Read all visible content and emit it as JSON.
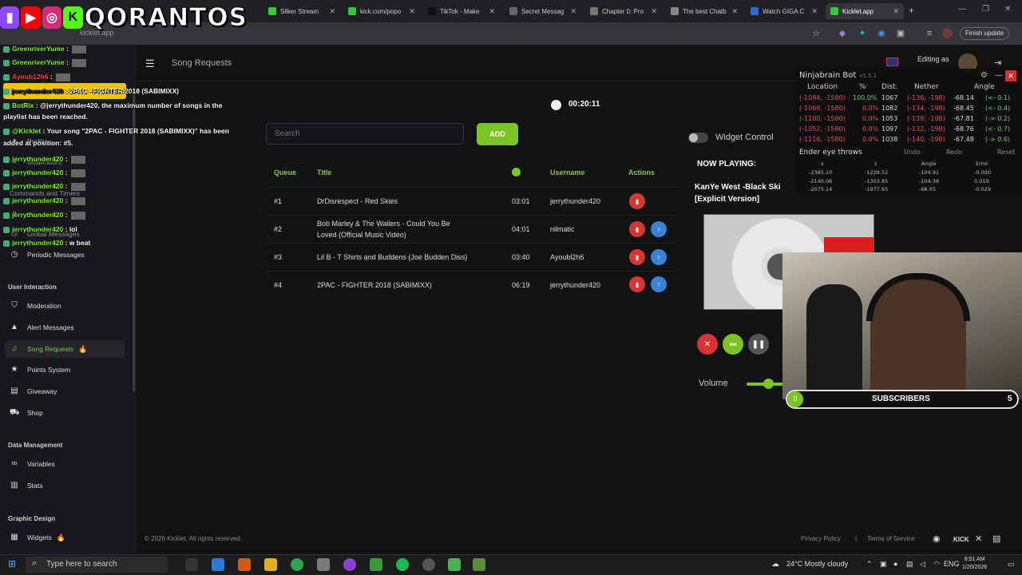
{
  "browser": {
    "tabs": [
      {
        "title": "Sliker Stream",
        "color": "#3ac73a"
      },
      {
        "title": "kick.com/popo",
        "color": "#3ac73a"
      },
      {
        "title": "TikTok - Make",
        "color": "#222222"
      },
      {
        "title": "Secret Messag",
        "color": "#666666"
      },
      {
        "title": "Chapter 0: Pro",
        "color": "#777777"
      },
      {
        "title": "The best Chatb",
        "color": "#888888"
      },
      {
        "title": "Watch GIGA C",
        "color": "#2b6cd6"
      },
      {
        "title": "Kicklet.app",
        "color": "#3ac73a"
      }
    ],
    "url": "kicklet.app",
    "finish_update": "Finish update"
  },
  "overlay_logo": "QORANTOS",
  "chat": [
    {
      "user": "GreenriverYume",
      "msg": ""
    },
    {
      "user": "GreenriverYume",
      "msg": ""
    },
    {
      "user": "Ayoub12h6",
      "msg": ""
    },
    {
      "user": "jerrythunder420",
      "msg": "2PAC - FIGHTER 2018 (SABIMIXX)"
    },
    {
      "user": "BotRix",
      "msg": "@jerrythunder420, the maximum number of songs in the"
    },
    {
      "user": "",
      "msg": "playlist has been reached."
    },
    {
      "user": "@Kicklet",
      "msg": "Your song \"2PAC - FIGHTER 2018 (SABIMIXX)\" has been"
    },
    {
      "user": "",
      "msg": "added at position: #5."
    },
    {
      "user": "jerrythunder420",
      "msg": ""
    },
    {
      "user": "jerrythunder420",
      "msg": ""
    },
    {
      "user": "jerrythunder420",
      "msg": ""
    },
    {
      "user": "jerrythunder420",
      "msg": ""
    },
    {
      "user": "jerrythunder420",
      "msg": ""
    },
    {
      "user": "jerrythunder420",
      "msg": "lol"
    },
    {
      "user": "jerrythunder420",
      "msg": "w beat"
    }
  ],
  "header": {
    "page_title": "Song Requests",
    "editing_as": "Editing as"
  },
  "sidebar": {
    "ghost_items": [
      "Profile",
      "Moderators",
      "Commands and Timers",
      "Counters",
      "Global Messages"
    ],
    "periodic": "Periodic Messages",
    "sections": {
      "user_interaction": "User Interaction",
      "data_management": "Data Management",
      "graphic_design": "Graphic Design"
    },
    "items": [
      {
        "label": "Moderation",
        "icon": "shield-icon"
      },
      {
        "label": "Alert Messages",
        "icon": "warning-icon"
      },
      {
        "label": "Song Requests",
        "icon": "music-icon"
      },
      {
        "label": "Points System",
        "icon": "star-icon"
      },
      {
        "label": "Giveaway",
        "icon": "gift-icon"
      },
      {
        "label": "Shop",
        "icon": "cart-icon"
      },
      {
        "label": "Variables",
        "icon": "link-icon"
      },
      {
        "label": "Stats",
        "icon": "chart-icon"
      },
      {
        "label": "Widgets",
        "icon": "widget-icon"
      }
    ]
  },
  "queue": {
    "timer": "00:20:11",
    "search_placeholder": "Search",
    "add_label": "ADD",
    "widget_control": "Widget Control",
    "headers": {
      "queue": "Queue",
      "title": "Title",
      "username": "Username",
      "actions": "Actions"
    },
    "rows": [
      {
        "pos": "#1",
        "title": "DrDisrespect - Red Skies",
        "title2": "",
        "duration": "03:01",
        "user": "jerrythunder420"
      },
      {
        "pos": "#2",
        "title": "Bob Marley & The Wailers - Could You Be",
        "title2": "Loved (Official Music Video)",
        "duration": "04:01",
        "user": "nilmatic"
      },
      {
        "pos": "#3",
        "title": "Lil B - T Shirts and Buddens (Joe Budden Diss)",
        "title2": "",
        "duration": "03:40",
        "user": "Ayoubl2h6"
      },
      {
        "pos": "#4",
        "title": "2PAC - FIGHTER 2018 (SABIMIXX)",
        "title2": "",
        "duration": "06:19",
        "user": "jerrythunder420"
      }
    ]
  },
  "now_playing": {
    "label": "NOW PLAYING:",
    "title": "KanYe West -Black Ski",
    "subtitle": "[Explicit Version]",
    "volume_label": "Volume",
    "volume": 0.45
  },
  "ninjabrain": {
    "title": "Ninjabrain Bot",
    "version": "v1.5.1",
    "headers": [
      "Location",
      "%",
      "Dist.",
      "Nether",
      "Angle"
    ],
    "rows": [
      [
        "(-1084, -1580)",
        "100.0%",
        "1067",
        "(-136, -198)",
        "-68.14",
        "(<- 0.1)"
      ],
      [
        "(-1068, -1580)",
        "0.0%",
        "1082",
        "(-134, -198)",
        "-68.45",
        "(<- 0.4)"
      ],
      [
        "(-1100, -1580)",
        "0.0%",
        "1053",
        "(-138, -198)",
        "-67.81",
        "(-> 0.2)"
      ],
      [
        "(-1052, -1580)",
        "0.0%",
        "1097",
        "(-132, -198)",
        "-68.76",
        "(<- 0.7)"
      ],
      [
        "(-1116, -1580)",
        "0.0%",
        "1038",
        "(-140, -198)",
        "-67.48",
        "(-> 0.6)"
      ]
    ],
    "ender_label": "Ender eye throws",
    "undo": "Undo",
    "redo": "Redo",
    "reset": "Reset",
    "throw_headers": [
      "x",
      "z",
      "Angle",
      "Error"
    ],
    "throws": [
      [
        "-2385.10",
        "-1228.52",
        "-104.91",
        "-0.000"
      ],
      [
        "-2140.06",
        "-1303.85",
        "-104.38",
        "0.019"
      ],
      [
        "-2075.14",
        "-1977.65",
        "-68.05",
        "-0.029"
      ]
    ]
  },
  "subs": {
    "label": "SUBSCRIBERS",
    "current": "0",
    "goal": "5"
  },
  "footer": {
    "copyright": "© 2026 Kicklet. All rights reserved.",
    "privacy": "Privacy Policy",
    "sep": "|",
    "terms": "Terms of Service"
  },
  "taskbar": {
    "search": "Type here to search",
    "weather": "24°C  Mostly cloudy",
    "lang": "ENG",
    "time": "8:51 AM",
    "date": "1/20/2026"
  }
}
